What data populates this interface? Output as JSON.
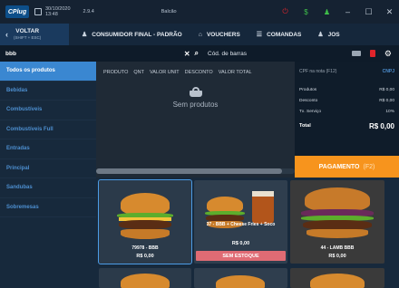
{
  "titlebar": {
    "logo": "CPlug",
    "date": "30/10/2020",
    "time": "13:48",
    "version": "2.9.4",
    "store": "Balcão"
  },
  "nav": {
    "back_label": "VOLTAR",
    "back_sub": "(SHIFT + ESC)",
    "customer": "CONSUMIDOR FINAL - PADRÃO",
    "vouchers": "VOUCHERS",
    "orders": "COMANDAS",
    "jos": "JOS"
  },
  "search": {
    "value": "bbb",
    "barcode_placeholder": "Cód. de barras"
  },
  "sidebar": {
    "items": [
      {
        "label": "Todos os produtos"
      },
      {
        "label": "Bebidas"
      },
      {
        "label": "Combustíveis"
      },
      {
        "label": "Combustíveis Full"
      },
      {
        "label": "Entradas"
      },
      {
        "label": "Principal"
      },
      {
        "label": "Sandubas"
      },
      {
        "label": "Sobremesas"
      }
    ]
  },
  "list": {
    "columns": [
      "PRODUTO",
      "QNT",
      "VALOR UNIT",
      "DESCONTO",
      "VALOR TOTAL"
    ],
    "empty_text": "Sem produtos"
  },
  "summary": {
    "cpf_label": "CPF na nota (F12)",
    "cnpj_label": "CNPJ",
    "rows": [
      {
        "label": "Produtos",
        "value": "R$ 0,00"
      },
      {
        "label": "Desconto",
        "value": "R$ 0,00"
      },
      {
        "label": "Tx. Serviço",
        "value": "10%"
      }
    ],
    "total_label": "Total",
    "total_value": "R$ 0,00"
  },
  "payment": {
    "label": "PAGAMENTO",
    "shortcut": "(F2)"
  },
  "products": [
    {
      "name": "79978 - BBB",
      "price": "R$ 0,00"
    },
    {
      "name": "37 - BBB + Cheese Fries + Soco",
      "price": "R$ 0,00",
      "badge": "SEM ESTOQUE"
    },
    {
      "name": "44 - LAMB BBB",
      "price": "R$ 0,00"
    }
  ],
  "colors": {
    "accent": "#3a87d1",
    "payment": "#f7941d",
    "danger": "#e0242b",
    "stock_badge": "#e06b74"
  }
}
